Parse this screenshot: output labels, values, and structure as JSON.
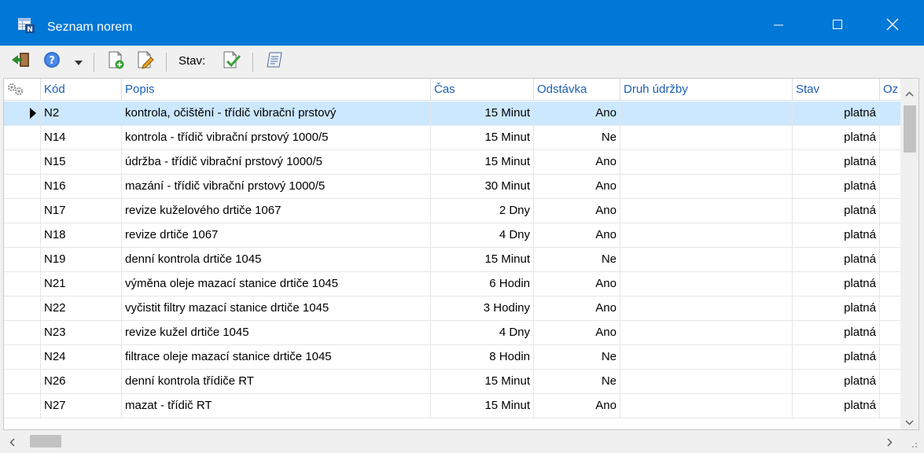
{
  "window": {
    "title": "Seznam norem",
    "icon": "table-list-icon",
    "controls": [
      "minimize-icon",
      "maximize-icon",
      "close-icon"
    ],
    "accent": "#0078d7"
  },
  "toolbar": {
    "status_label": "Stav:",
    "buttons": [
      "exit-icon",
      "help-icon",
      "dropdown-arrow-icon",
      "new-document-icon",
      "edit-document-icon",
      "approve-document-icon",
      "list-note-icon"
    ]
  },
  "table": {
    "columns": [
      "Kód",
      "Popis",
      "Čas",
      "Odstávka",
      "Druh údržby",
      "Stav",
      "Oz"
    ],
    "selected_color": "#cce8ff",
    "header_color": "#1a5fb4",
    "rows": [
      {
        "kod": "N2",
        "popis": "kontrola, očištění - třídič vibrační prstový",
        "cas": "15 Minut",
        "odstavka": "Ano",
        "druh": "",
        "stav": "platná",
        "selected": true
      },
      {
        "kod": "N14",
        "popis": "kontrola - třídič vibrační prstový 1000/5",
        "cas": "15 Minut",
        "odstavka": "Ne",
        "druh": "",
        "stav": "platná"
      },
      {
        "kod": "N15",
        "popis": "údržba - třídič vibrační prstový 1000/5",
        "cas": "15 Minut",
        "odstavka": "Ano",
        "druh": "",
        "stav": "platná"
      },
      {
        "kod": "N16",
        "popis": "mazání - třídič vibrační prstový 1000/5",
        "cas": "30 Minut",
        "odstavka": "Ano",
        "druh": "",
        "stav": "platná"
      },
      {
        "kod": "N17",
        "popis": "revize kuželového drtiče 1067",
        "cas": "2 Dny",
        "odstavka": "Ano",
        "druh": "",
        "stav": "platná"
      },
      {
        "kod": "N18",
        "popis": "revize drtiče 1067",
        "cas": "4 Dny",
        "odstavka": "Ano",
        "druh": "",
        "stav": "platná"
      },
      {
        "kod": "N19",
        "popis": "denní kontrola drtiče 1045",
        "cas": "15 Minut",
        "odstavka": "Ne",
        "druh": "",
        "stav": "platná"
      },
      {
        "kod": "N21",
        "popis": "výměna oleje mazací stanice drtiče 1045",
        "cas": "6 Hodin",
        "odstavka": "Ano",
        "druh": "",
        "stav": "platná"
      },
      {
        "kod": "N22",
        "popis": "vyčistit filtry mazací stanice drtiče 1045",
        "cas": "3 Hodiny",
        "odstavka": "Ano",
        "druh": "",
        "stav": "platná"
      },
      {
        "kod": "N23",
        "popis": "revize kužel drtiče 1045",
        "cas": "4 Dny",
        "odstavka": "Ano",
        "druh": "",
        "stav": "platná"
      },
      {
        "kod": "N24",
        "popis": "filtrace oleje mazací stanice drtiče 1045",
        "cas": "8 Hodin",
        "odstavka": "Ne",
        "druh": "",
        "stav": "platná"
      },
      {
        "kod": "N26",
        "popis": "denní kontrola třídiče RT",
        "cas": "15 Minut",
        "odstavka": "Ne",
        "druh": "",
        "stav": "platná"
      },
      {
        "kod": "N27",
        "popis": "mazat - třídič RT",
        "cas": "15 Minut",
        "odstavka": "Ano",
        "druh": "",
        "stav": "platná"
      }
    ]
  }
}
